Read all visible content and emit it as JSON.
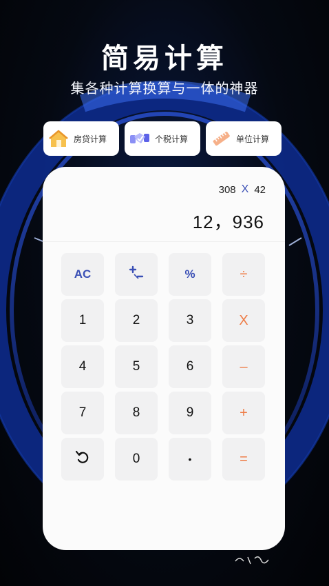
{
  "header": {
    "title": "简易计算",
    "subtitle": "集各种计算换算与一体的神器"
  },
  "tools": [
    {
      "label": "房贷计算",
      "icon": "house-icon",
      "color": "#f5b93e"
    },
    {
      "label": "个税计算",
      "icon": "handshake-icon",
      "color": "#6a6ff0"
    },
    {
      "label": "单位计算",
      "icon": "ruler-icon",
      "color": "#f08a5d"
    }
  ],
  "calculator": {
    "expression": {
      "left": "308",
      "operator": "X",
      "right": "42"
    },
    "result": "12，936",
    "keys": {
      "ac": "AC",
      "sign": "+/-",
      "percent": "%",
      "divide": "÷",
      "k1": "1",
      "k2": "2",
      "k3": "3",
      "multiply": "X",
      "k4": "4",
      "k5": "5",
      "k6": "6",
      "minus": "–",
      "k7": "7",
      "k8": "8",
      "k9": "9",
      "plus": "+",
      "k0": "0",
      "dot": "•",
      "equals": "="
    }
  },
  "colors": {
    "accent_blue": "#3a4fb5",
    "accent_orange": "#ee7b45",
    "card_bg": "#fbfbfb",
    "key_bg": "#f1f1f2"
  }
}
